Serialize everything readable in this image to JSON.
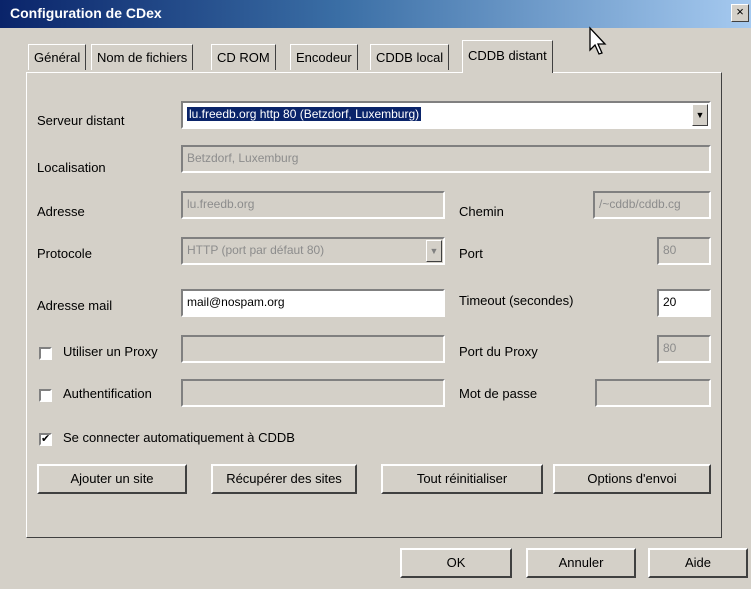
{
  "window": {
    "title": "Configuration de CDex",
    "close_glyph": "×"
  },
  "tabs": [
    {
      "label": "Général"
    },
    {
      "label": "Nom de fichiers"
    },
    {
      "label": "CD ROM"
    },
    {
      "label": "Encodeur"
    },
    {
      "label": "CDDB local"
    },
    {
      "label": "CDDB distant"
    }
  ],
  "active_tab": "CDDB distant",
  "form": {
    "serveur_label": "Serveur distant",
    "serveur_value": "lu.freedb.org http  80  (Betzdorf, Luxemburg)",
    "localisation_label": "Localisation",
    "localisation_value": "Betzdorf, Luxemburg",
    "adresse_label": "Adresse",
    "adresse_value": "lu.freedb.org",
    "chemin_label": "Chemin",
    "chemin_value": "/~cddb/cddb.cg",
    "protocole_label": "Protocole",
    "protocole_value": "HTTP (port par défaut 80)",
    "port_label": "Port",
    "port_value": "80",
    "mail_label": "Adresse mail",
    "mail_value": "mail@nospam.org",
    "timeout_label": "Timeout (secondes)",
    "timeout_value": "20",
    "proxy_label": "Utiliser un Proxy",
    "proxy_checked": false,
    "proxy_value": "",
    "proxy_port_label": "Port du Proxy",
    "proxy_port_value": "80",
    "auth_label": "Authentification",
    "auth_checked": false,
    "auth_value": "",
    "password_label": "Mot de passe",
    "password_value": "",
    "auto_connect_label": "Se connecter automatiquement à CDDB",
    "auto_connect_checked": true
  },
  "actions": {
    "add_site": "Ajouter un site",
    "fetch_sites": "Récupérer des sites",
    "reset_all": "Tout réinitialiser",
    "send_options": "Options d'envoi"
  },
  "footer": {
    "ok": "OK",
    "cancel": "Annuler",
    "help": "Aide"
  },
  "icons": {
    "checkmark": "✔",
    "combo_arrow": "▼"
  }
}
